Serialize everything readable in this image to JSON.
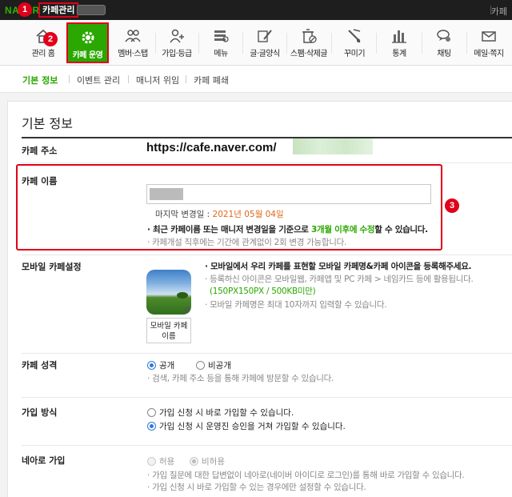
{
  "topbar": {
    "logo": "NAVER",
    "cafe_manage_label": "카페관리",
    "right_text": "카페"
  },
  "badges": {
    "b1": "1",
    "b2": "2",
    "b3": "3"
  },
  "menu": [
    {
      "label": "관리 홈",
      "icon": "home-icon"
    },
    {
      "label": "카페 운영",
      "icon": "gear-icon",
      "active": true
    },
    {
      "label": "멤버·스탭",
      "icon": "members-icon"
    },
    {
      "label": "가입·등급",
      "icon": "user-add-icon"
    },
    {
      "label": "메뉴",
      "icon": "menu-list-icon"
    },
    {
      "label": "글·글양식",
      "icon": "pencil-icon"
    },
    {
      "label": "스팸·삭제글",
      "icon": "trash-icon"
    },
    {
      "label": "꾸미기",
      "icon": "brush-icon"
    },
    {
      "label": "통계",
      "icon": "bar-chart-icon"
    },
    {
      "label": "채팅",
      "icon": "chat-icon"
    },
    {
      "label": "메일·쪽지",
      "icon": "mail-icon"
    }
  ],
  "subtabs": [
    "기본 정보",
    "이벤트 관리",
    "매니저 위임",
    "카페 폐쇄"
  ],
  "page_title": "기본 정보",
  "cafe_address": {
    "label": "카페 주소",
    "url_prefix": "https://cafe.naver.com/"
  },
  "cafe_name": {
    "label": "카페 이름",
    "last_change_prefix": "마지막 변경일 : ",
    "last_change_date": "2021년 05월 04일",
    "note1_prefix": "최근 카페이름 또는 매니저 변경일을 기준으로 ",
    "note1_highlight": "3개월 이후에 수정",
    "note1_suffix": "할 수 있습니다.",
    "note2": "카페개설 직후에는 기간에 관계없이 2회 변경 가능합니다."
  },
  "mobile": {
    "label": "모바일 카페설정",
    "name_box": "모바일 카페 이름",
    "desc1": "모바일에서 우리 카페를 표현할 모바일 카페명&카페 아이콘을 등록해주세요.",
    "desc2": "등록하신 아이콘은 모바일웹, 카페앱 및 PC 카페 > 네임카드 등에 활용됩니다.",
    "desc3": "(150PX150PX / 500KB미만)",
    "desc4": "모바일 카페명은 최대 10자까지 입력할 수 있습니다."
  },
  "character": {
    "label": "카페 성격",
    "opt_public": "공개",
    "opt_private": "비공개",
    "selected": "공개",
    "note": "검색, 카페 주소 등을 통해 카페에 방문할 수 있습니다."
  },
  "join": {
    "label": "가입 방식",
    "opt1": "가입 신청 시 바로 가입할 수 있습니다.",
    "opt2": "가입 신청 시 운영진 승인을 거쳐 가입할 수 있습니다.",
    "selected": "opt2"
  },
  "naver_join": {
    "label": "네아로 가입",
    "opt_allow": "허용",
    "opt_deny": "비허용",
    "selected": "비허용",
    "note1": "가입 질문에 대한 답변없이 네아로(네이버 아이디로 로그인)를 통해 바로 가입할 수 있습니다.",
    "note2": "가입 신청 시 바로 가입할 수 있는 경우에만 설정할 수 있습니다."
  },
  "colors": {
    "accent_green": "#2aa700",
    "highlight_red": "#e0001a",
    "date_orange": "#e0671a"
  }
}
